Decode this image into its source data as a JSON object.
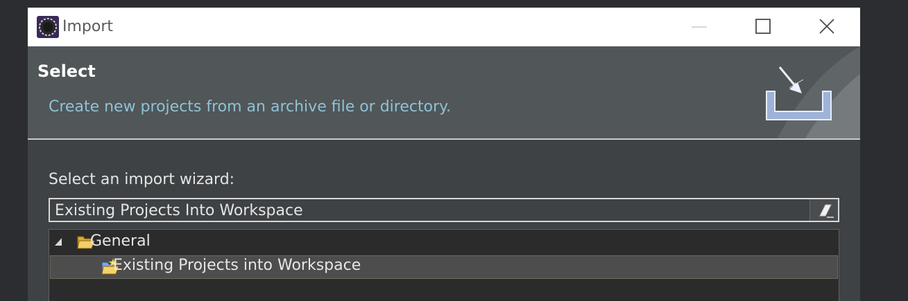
{
  "window": {
    "title": "Import",
    "minimize_icon": "minimize-icon",
    "maximize_icon": "maximize-icon",
    "close_icon": "close-icon"
  },
  "header": {
    "title": "Select",
    "description": "Create new projects from an archive file or directory.",
    "banner_icon": "import-wizard-banner-icon"
  },
  "body": {
    "prompt": "Select an import wizard:",
    "filter_value": "Existing Projects Into Workspace",
    "clear_icon": "eraser-icon"
  },
  "tree": {
    "items": [
      {
        "label": "General",
        "expanded": true,
        "icon": "open-folder-icon"
      },
      {
        "label": "Existing Projects into Workspace",
        "selected": true,
        "icon": "import-project-icon"
      }
    ]
  },
  "colors": {
    "titlebar_bg": "#ffffff",
    "header_bg": "#515658",
    "description_text": "#8fc2d6",
    "body_bg": "#3e4245",
    "tree_bg": "#2b2b2b",
    "selected_row_bg": "#4d4d4d"
  }
}
